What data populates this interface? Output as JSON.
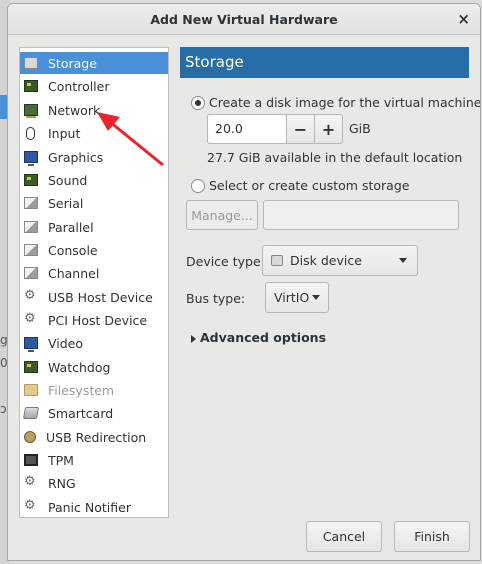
{
  "window": {
    "title": "Add New Virtual Hardware",
    "close_symbol": "×"
  },
  "background_fragments": [
    "ge",
    "0",
    "ɔ"
  ],
  "hardware_list": [
    {
      "label": "Storage",
      "icon": "disk-icon",
      "selected": true,
      "disabled": false
    },
    {
      "label": "Controller",
      "icon": "board-icon",
      "selected": false,
      "disabled": false
    },
    {
      "label": "Network",
      "icon": "network-card-icon",
      "selected": false,
      "disabled": false
    },
    {
      "label": "Input",
      "icon": "mouse-icon",
      "selected": false,
      "disabled": false
    },
    {
      "label": "Graphics",
      "icon": "monitor-icon",
      "selected": false,
      "disabled": false
    },
    {
      "label": "Sound",
      "icon": "board-icon",
      "selected": false,
      "disabled": false
    },
    {
      "label": "Serial",
      "icon": "port-icon",
      "selected": false,
      "disabled": false
    },
    {
      "label": "Parallel",
      "icon": "port-icon",
      "selected": false,
      "disabled": false
    },
    {
      "label": "Console",
      "icon": "port-icon",
      "selected": false,
      "disabled": false
    },
    {
      "label": "Channel",
      "icon": "port-icon",
      "selected": false,
      "disabled": false
    },
    {
      "label": "USB Host Device",
      "icon": "usb-icon",
      "selected": false,
      "disabled": false
    },
    {
      "label": "PCI Host Device",
      "icon": "usb-icon",
      "selected": false,
      "disabled": false
    },
    {
      "label": "Video",
      "icon": "monitor-icon",
      "selected": false,
      "disabled": false
    },
    {
      "label": "Watchdog",
      "icon": "board-icon",
      "selected": false,
      "disabled": false
    },
    {
      "label": "Filesystem",
      "icon": "folder-icon",
      "selected": false,
      "disabled": true
    },
    {
      "label": "Smartcard",
      "icon": "smartcard-icon",
      "selected": false,
      "disabled": false
    },
    {
      "label": "USB Redirection",
      "icon": "redirection-icon",
      "selected": false,
      "disabled": false
    },
    {
      "label": "TPM",
      "icon": "chip-icon",
      "selected": false,
      "disabled": false
    },
    {
      "label": "RNG",
      "icon": "usb-icon",
      "selected": false,
      "disabled": false
    },
    {
      "label": "Panic Notifier",
      "icon": "usb-icon",
      "selected": false,
      "disabled": false
    }
  ],
  "storage": {
    "header": "Storage",
    "create_radio_label": "Create a disk image for the virtual machine",
    "size_value": "20.0",
    "minus_label": "−",
    "plus_label": "+",
    "size_unit": "GiB",
    "available_text": "27.7 GiB available in the default location",
    "custom_radio_label": "Select or create custom storage",
    "manage_button": "Manage...",
    "custom_path_value": "",
    "device_type_label": "Device type:",
    "device_type_value": "Disk device",
    "bus_type_label": "Bus type:",
    "bus_type_value": "VirtIO",
    "advanced_label": "Advanced options"
  },
  "footer": {
    "cancel_label": "Cancel",
    "finish_label": "Finish"
  },
  "colors": {
    "selection": "#4a90d9",
    "section_header": "#276ea8",
    "annotation_arrow": "#e8252a"
  }
}
